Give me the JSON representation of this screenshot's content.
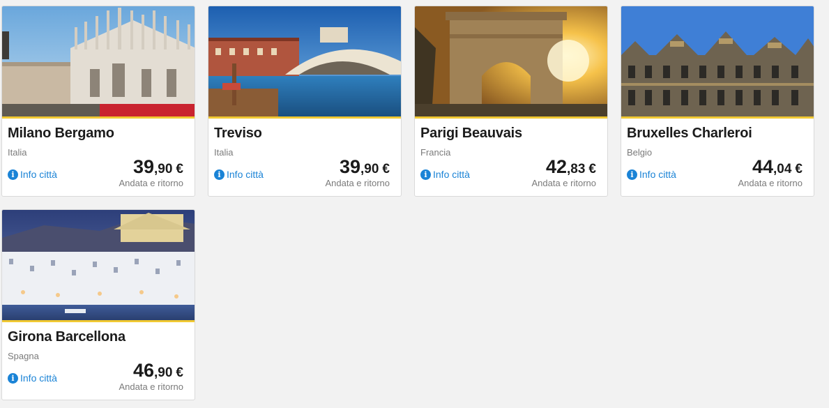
{
  "destinations": [
    {
      "city": "Milano Bergamo",
      "country": "Italia",
      "info_label": "Info città",
      "price_int": "39",
      "price_dec": ",90",
      "currency": "€",
      "trip_type": "Andata e ritorno"
    },
    {
      "city": "Treviso",
      "country": "Italia",
      "info_label": "Info città",
      "price_int": "39",
      "price_dec": ",90",
      "currency": "€",
      "trip_type": "Andata e ritorno"
    },
    {
      "city": "Parigi Beauvais",
      "country": "Francia",
      "info_label": "Info città",
      "price_int": "42",
      "price_dec": ",83",
      "currency": "€",
      "trip_type": "Andata e ritorno"
    },
    {
      "city": "Bruxelles Charleroi",
      "country": "Belgio",
      "info_label": "Info città",
      "price_int": "44",
      "price_dec": ",04",
      "currency": "€",
      "trip_type": "Andata e ritorno"
    },
    {
      "city": "Girona Barcellona",
      "country": "Spagna",
      "info_label": "Info città",
      "price_int": "46",
      "price_dec": ",90",
      "currency": "€",
      "trip_type": "Andata e ritorno"
    }
  ],
  "colors": {
    "accent": "#f1c933",
    "link": "#1a83d6",
    "background": "#f2f2f2"
  },
  "icons": {
    "info": "info-circle-icon"
  }
}
